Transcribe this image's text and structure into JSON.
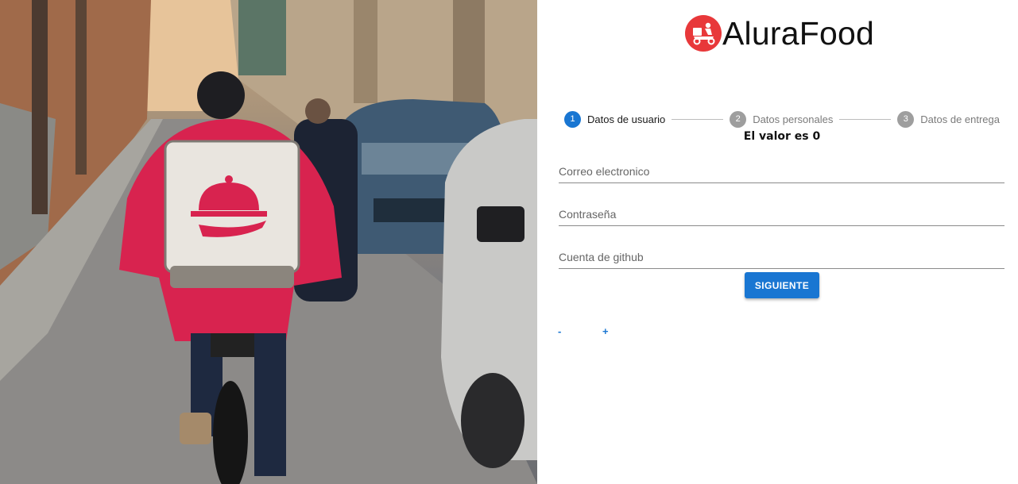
{
  "brand": {
    "name": "AluraFood",
    "logo_icon": "delivery-scooter-icon",
    "logo_color": "#e8383a"
  },
  "stepper": {
    "steps": [
      {
        "number": "1",
        "label": "Datos de usuario",
        "active": true
      },
      {
        "number": "2",
        "label": "Datos personales",
        "active": false
      },
      {
        "number": "3",
        "label": "Datos de entrega",
        "active": false
      }
    ],
    "active_color": "#1976d2",
    "inactive_color": "#9e9e9e"
  },
  "counter": {
    "text": "El valor es 0",
    "decrement_label": "-",
    "increment_label": "+"
  },
  "form": {
    "email": {
      "placeholder": "Correo electronico",
      "value": ""
    },
    "password": {
      "placeholder": "Contraseña",
      "value": ""
    },
    "github": {
      "placeholder": "Cuenta de github",
      "value": ""
    },
    "submit_label": "SIGUIENTE"
  },
  "hero_image": {
    "subject": "delivery-cyclist-photo"
  }
}
